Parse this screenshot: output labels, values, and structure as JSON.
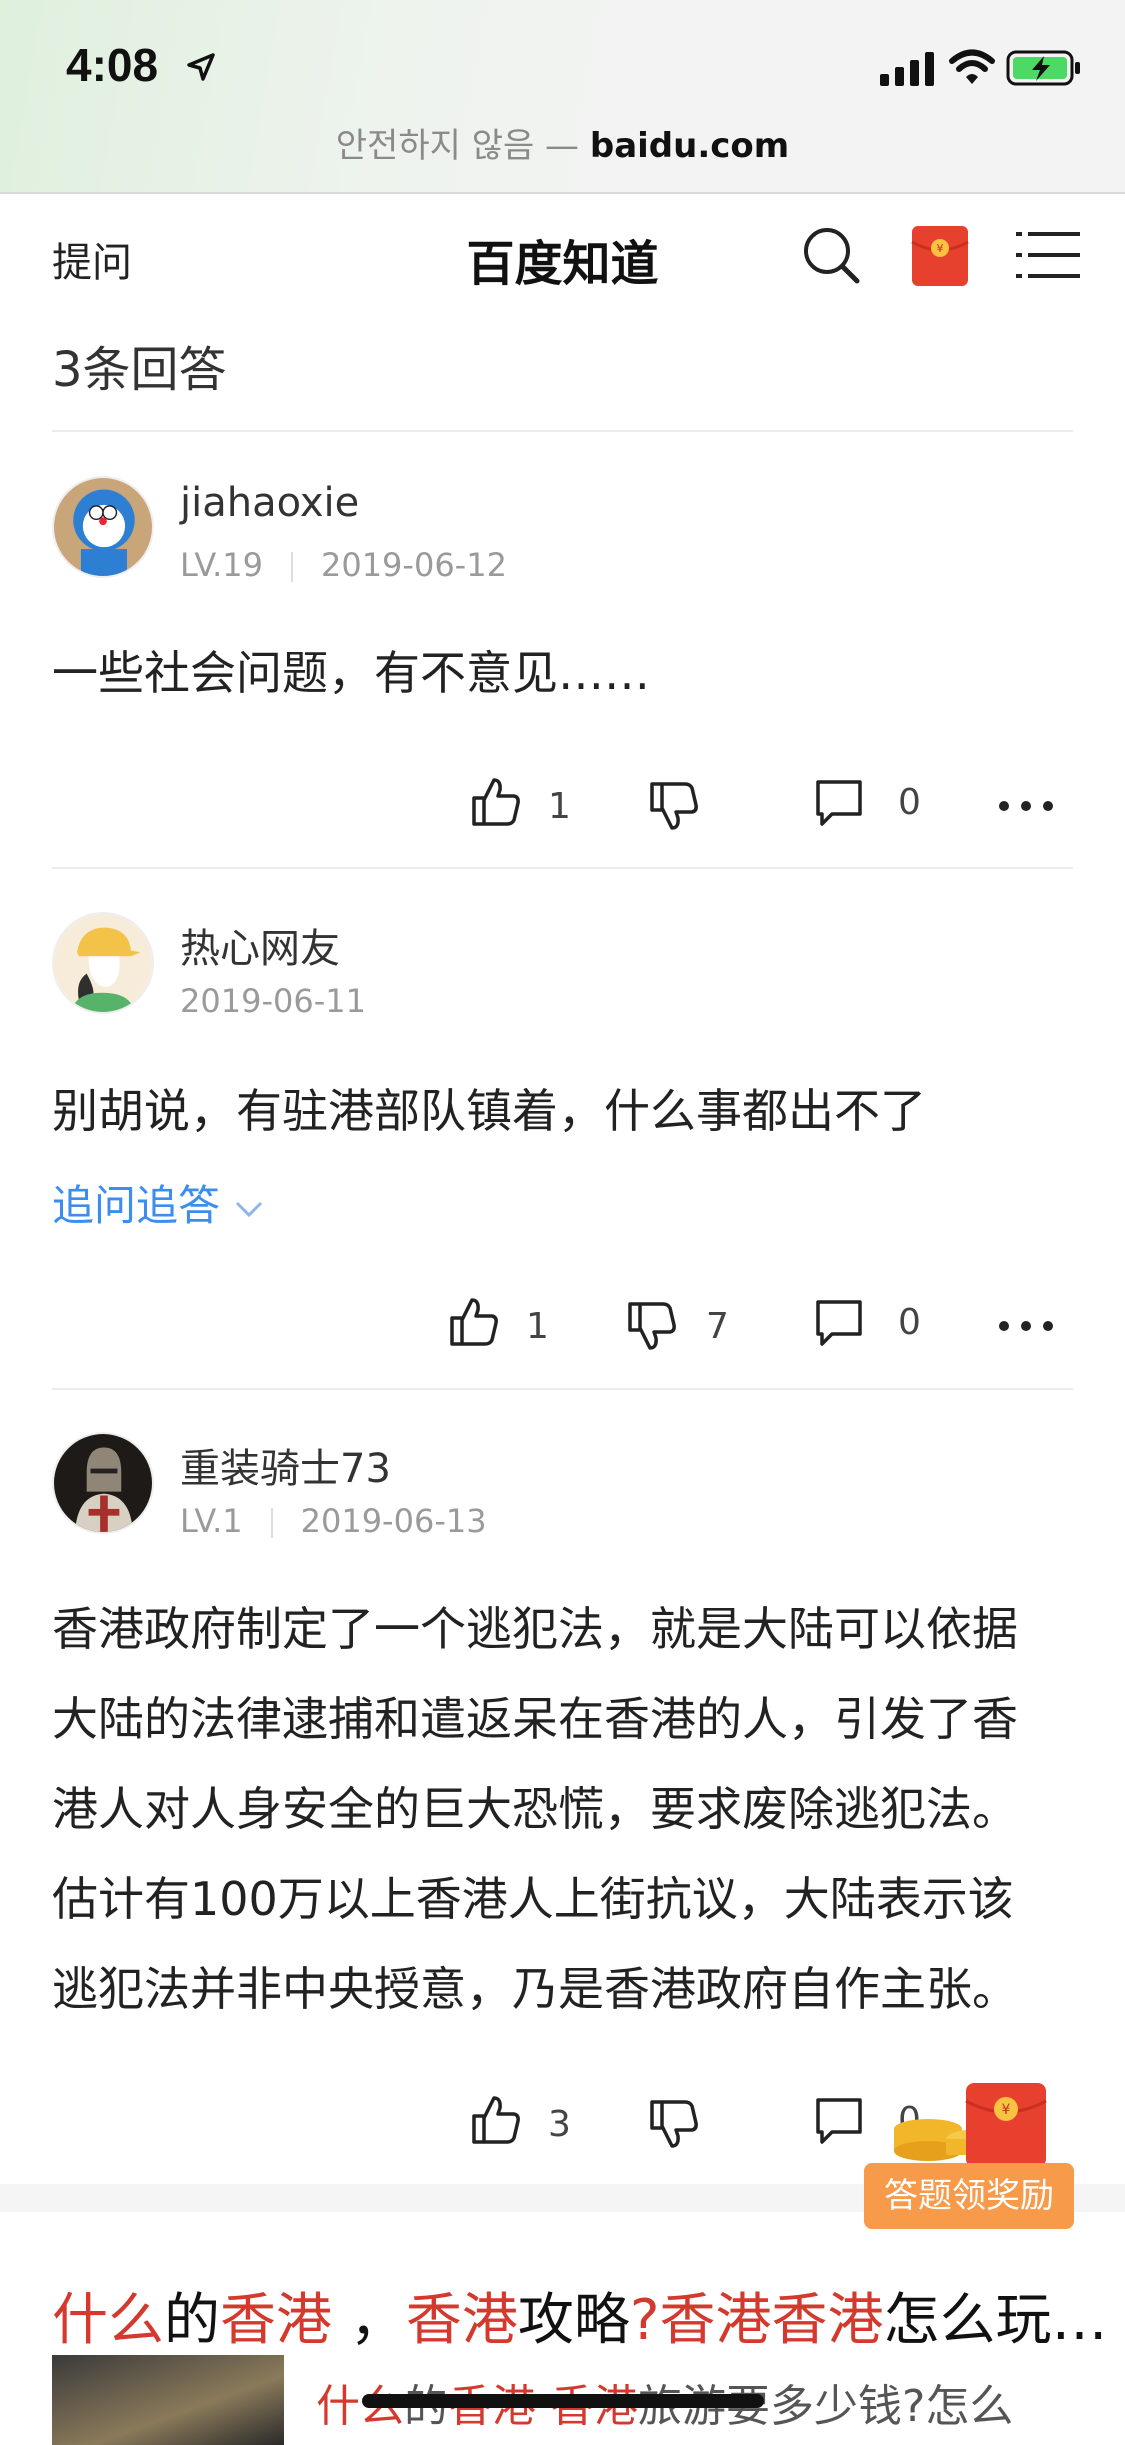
{
  "status": {
    "time": "4:08"
  },
  "browser": {
    "url_prefix": "안전하지 않음 — ",
    "url_host": "baidu.com"
  },
  "header": {
    "ask_label": "提问",
    "title": "百度知道"
  },
  "answers_count": "3条回答",
  "answers": [
    {
      "username": "jiahaoxie",
      "level": "LV.19",
      "date": "2019-06-12",
      "text": "一些社会问题，有不意见……",
      "likes": "1",
      "dislikes": "",
      "comments": "0"
    },
    {
      "username": "热心网友",
      "date": "2019-06-11",
      "text": "别胡说，有驻港部队镇着，什么事都出不了",
      "followup": "追问追答",
      "likes": "1",
      "dislikes": "7",
      "comments": "0"
    },
    {
      "username": "重装骑士73",
      "level": "LV.1",
      "date": "2019-06-13",
      "text_lines": [
        "香港政府制定了一个逃犯法，就是大陆可以依据",
        "大陆的法律逮捕和遣返呆在香港的人，引发了香",
        "港人对人身安全的巨大恐慌，要求废除逃犯法。",
        "估计有100万以上香港人上街抗议，大陆表示该",
        "逃犯法并非中央授意，乃是香港政府自作主张。"
      ],
      "likes": "3",
      "dislikes": "",
      "comments": "0"
    }
  ],
  "reward": {
    "label": "答题领奖励"
  },
  "related": {
    "title_parts": [
      {
        "t": "什么",
        "hl": true
      },
      {
        "t": "的",
        "hl": false
      },
      {
        "t": "香港",
        "hl": true
      },
      {
        "t": " ，",
        "hl": false
      },
      {
        "t": "香港",
        "hl": true
      },
      {
        "t": "攻略",
        "hl": false
      },
      {
        "t": "?香港香港",
        "hl": true
      },
      {
        "t": "怎么玩…",
        "hl": false
      }
    ],
    "sub_parts": [
      {
        "t": "什么",
        "hl": true
      },
      {
        "t": "的",
        "hl": false
      },
      {
        "t": "香港 香港",
        "hl": true
      },
      {
        "t": "旅游要多少钱?怎么",
        "hl": false
      }
    ]
  },
  "colors": {
    "link": "#3b8ef0",
    "highlight": "#d4392d",
    "reward": "#f79a4a"
  }
}
